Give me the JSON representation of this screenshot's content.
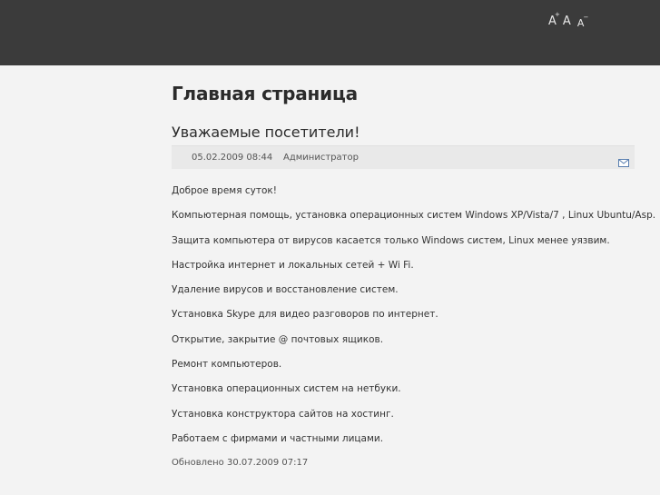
{
  "header": {
    "font_controls": {
      "increase": "A",
      "increase_sup": "+",
      "reset": "A",
      "decrease": "A",
      "decrease_sup": "−"
    }
  },
  "main": {
    "page_title": "Главная страница",
    "article": {
      "title": "Уважаемые посетители!",
      "date": "05.02.2009 08:44",
      "author": "Администратор",
      "icon": "email-icon",
      "paragraphs": [
        "Доброе время суток!",
        "Компьютерная помощь, установка операционных систем Windows XP/Vista/7 , Linux Ubuntu/Asp.",
        "Защита компьютера от вирусов касается только Windows систем, Linux менее уязвим.",
        "Настройка интернет и локальных сетей +  Wi Fi.",
        "Удаление вирусов и восстановление систем.",
        "Установка Skype для видео разговоров по интернет.",
        "Открытие, закрытие @ почтовых ящиков.",
        "Ремонт компьютеров.",
        "Установка операционных систем на нетбуки.",
        "Установка конструктора сайтов на хостинг.",
        "Работаем с фирмами и частными лицами."
      ],
      "updated": "Обновлено 30.07.2009 07:17"
    }
  },
  "colors": {
    "header_bg": "#3b3b3b",
    "page_bg": "#f3f3f3",
    "meta_bg": "#e9e9e9"
  }
}
